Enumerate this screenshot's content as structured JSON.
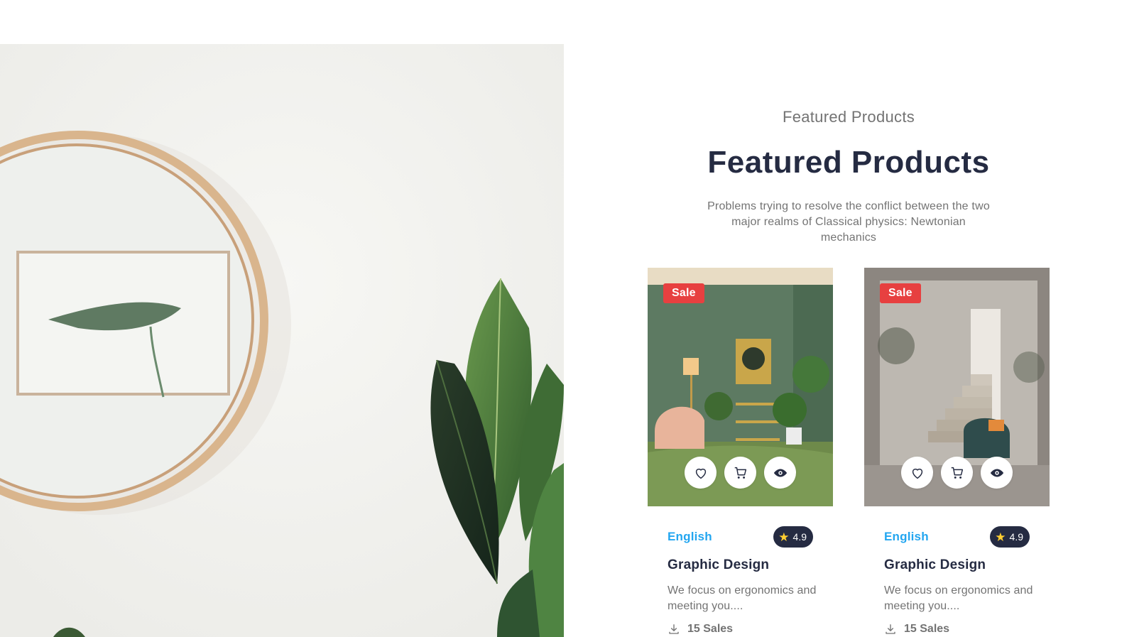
{
  "section": {
    "eyebrow": "Featured Products",
    "headline": "Featured Products",
    "description": "Problems trying to resolve the conflict between the two major realms of Classical physics: Newtonian mechanics"
  },
  "products": [
    {
      "badge": "Sale",
      "category": "English",
      "rating": "4.9",
      "title": "Graphic Design",
      "description": "We focus on ergonomics and meeting you....",
      "sales": "15 Sales",
      "image": "green living room with armchair, lamp and plants"
    },
    {
      "badge": "Sale",
      "category": "English",
      "rating": "4.9",
      "title": "Graphic Design",
      "description": "We focus on ergonomics and meeting you....",
      "sales": "15 Sales",
      "image": "grey room with staircase and teal chair"
    }
  ],
  "icons": {
    "wishlist": "heart-icon",
    "cart": "cart-icon",
    "view": "eye-icon",
    "rating": "star-icon",
    "sales": "download-icon"
  },
  "colors": {
    "heading": "#252b42",
    "muted": "#737373",
    "accent": "#23a6f0",
    "sale": "#e74040",
    "star": "#ffce31"
  }
}
